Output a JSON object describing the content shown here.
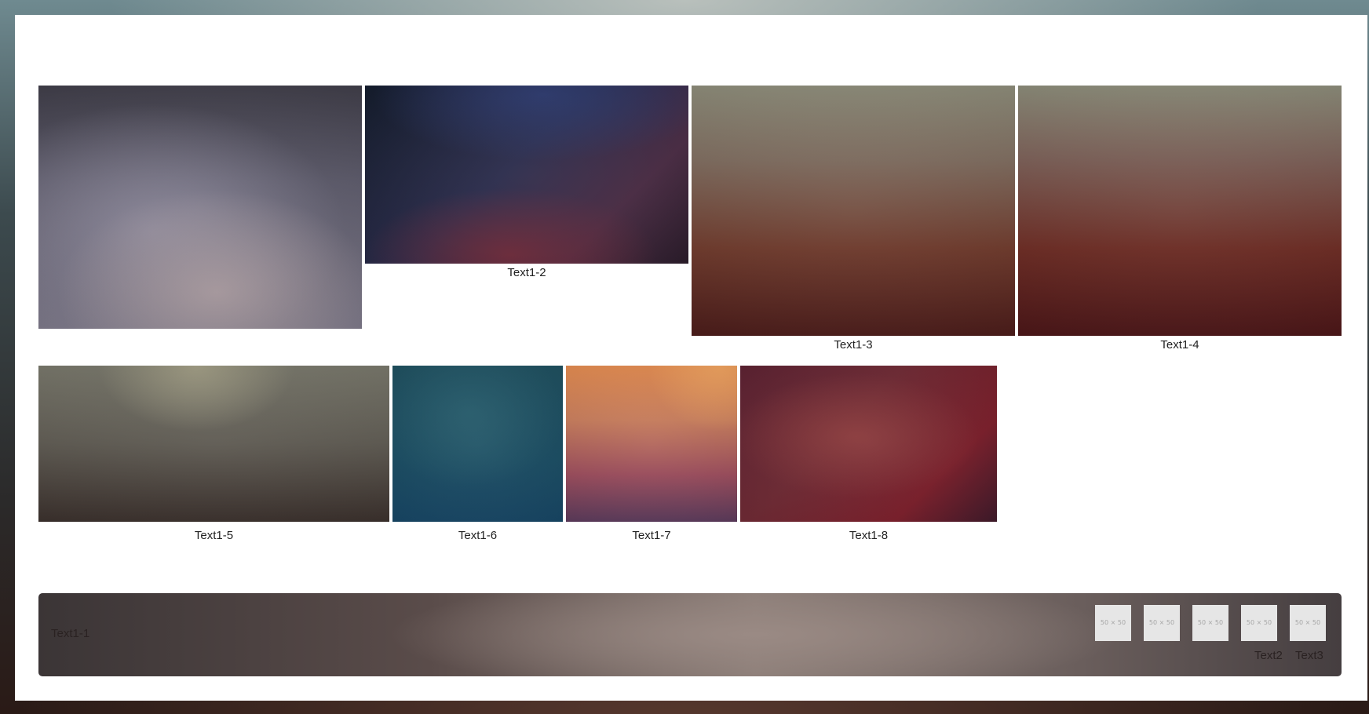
{
  "gallery": {
    "items": [
      {
        "caption": ""
      },
      {
        "caption": "Text1-2"
      },
      {
        "caption": "Text1-3"
      },
      {
        "caption": "Text1-4"
      },
      {
        "caption": "Text1-5"
      },
      {
        "caption": "Text1-6"
      },
      {
        "caption": "Text1-7"
      },
      {
        "caption": "Text1-8"
      }
    ]
  },
  "footer": {
    "label": "Text1-1",
    "thumbnails": [
      {
        "placeholder": "50 × 50"
      },
      {
        "placeholder": "50 × 50"
      },
      {
        "placeholder": "50 × 50"
      },
      {
        "placeholder": "50 × 50"
      },
      {
        "placeholder": "50 × 50"
      }
    ],
    "thumbnail_labels": {
      "text2": "Text2",
      "text3": "Text3"
    }
  },
  "colors": {
    "panel": "#ffffff",
    "placeholder_bg": "#e6e6e6",
    "caption_text": "#222222"
  }
}
